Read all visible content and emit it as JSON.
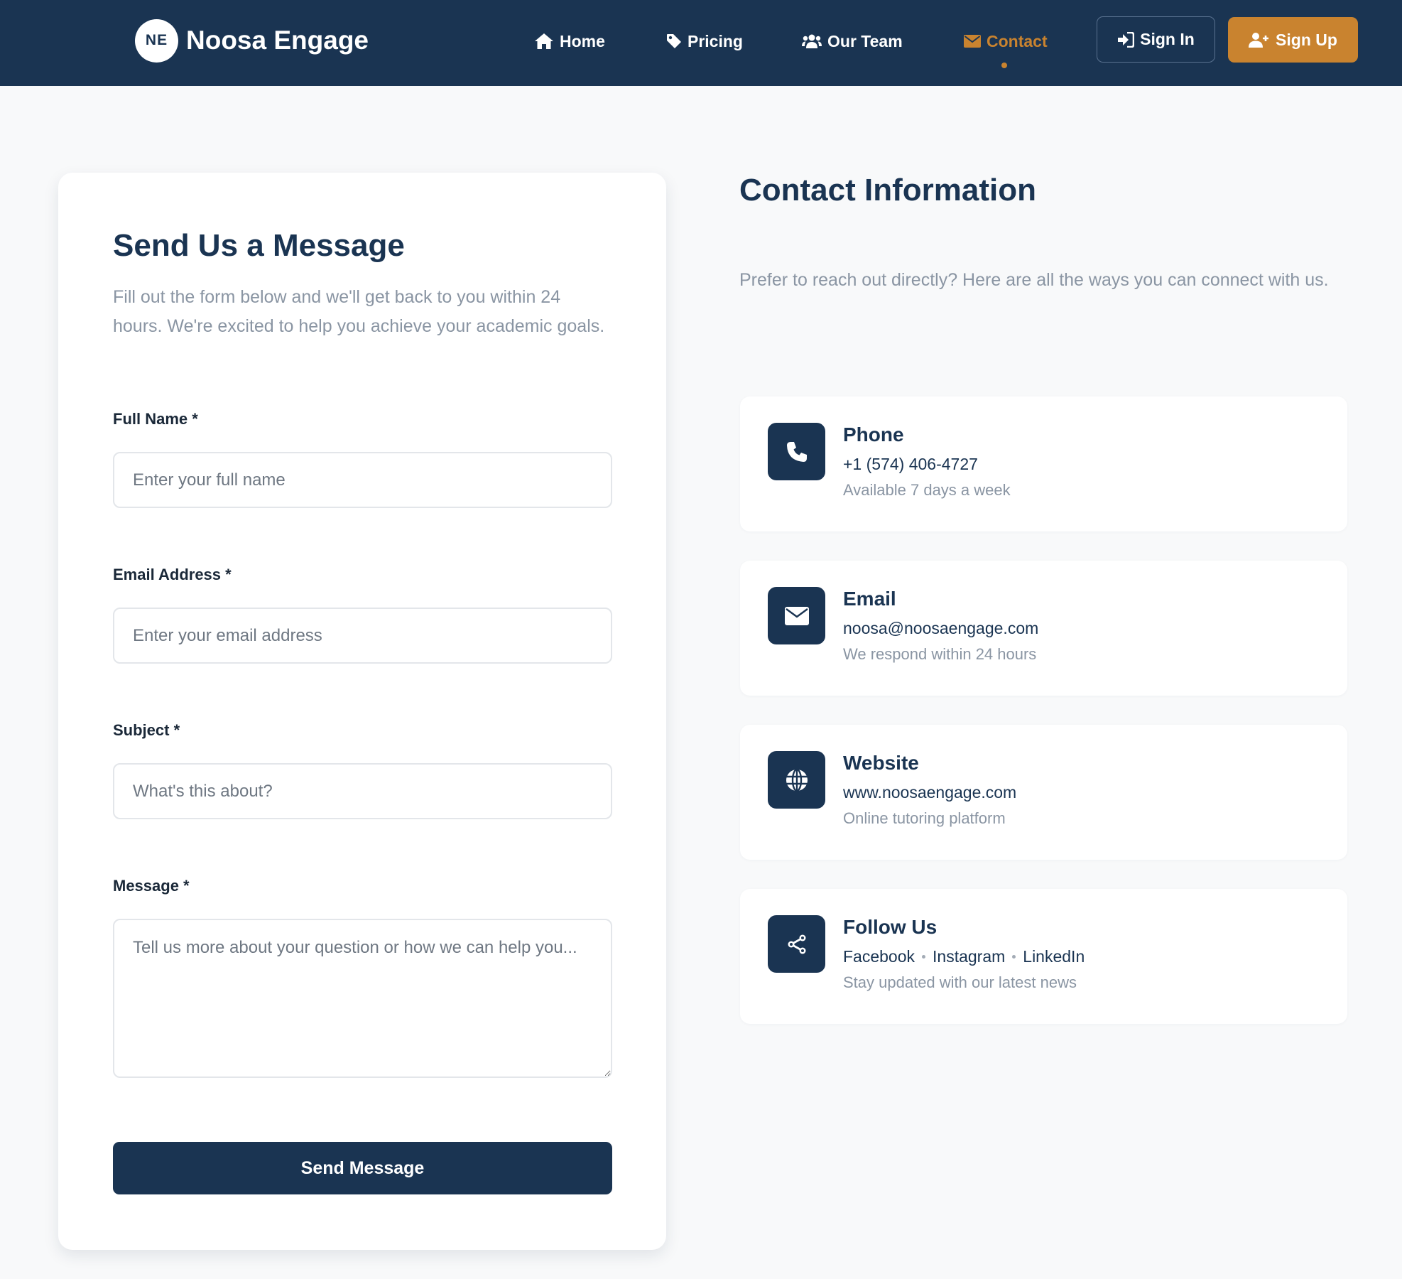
{
  "brand": {
    "logo_text": "NE",
    "name": "Noosa Engage"
  },
  "nav": {
    "links": [
      {
        "label": "Home",
        "icon": "home-icon"
      },
      {
        "label": "Pricing",
        "icon": "tag-icon"
      },
      {
        "label": "Our Team",
        "icon": "users-icon"
      },
      {
        "label": "Contact",
        "icon": "envelope-icon",
        "active": true
      }
    ],
    "sign_in": "Sign In",
    "sign_up": "Sign Up"
  },
  "form": {
    "title": "Send Us a Message",
    "subtitle": "Fill out the form below and we'll get back to you within 24 hours. We're excited to help you achieve your academic goals.",
    "fields": [
      {
        "label": "Full Name *",
        "placeholder": "Enter your full name"
      },
      {
        "label": "Email Address *",
        "placeholder": "Enter your email address"
      },
      {
        "label": "Subject *",
        "placeholder": "What's this about?"
      },
      {
        "label": "Message *",
        "placeholder": "Tell us more about your question or how we can help you..."
      }
    ],
    "submit": "Send Message"
  },
  "contact": {
    "title": "Contact Information",
    "subtitle": "Prefer to reach out directly? Here are all the ways you can connect with us.",
    "cards": [
      {
        "name": "Phone",
        "value": "+1 (574) 406-4727",
        "note": "Available 7 days a week",
        "icon": "phone-icon"
      },
      {
        "name": "Email",
        "value": "noosa@noosaengage.com",
        "note": "We respond within 24 hours",
        "icon": "envelope-icon"
      },
      {
        "name": "Website",
        "value": "www.noosaengage.com",
        "note": "Online tutoring platform",
        "icon": "globe-icon"
      },
      {
        "name": "Follow Us",
        "socials": [
          "Facebook",
          "Instagram",
          "LinkedIn"
        ],
        "note": "Stay updated with our latest news",
        "icon": "share-icon"
      }
    ]
  },
  "colors": {
    "navy": "#1a3452",
    "accent": "#c9832f",
    "muted": "#8a95a3",
    "background": "#f8f9fa"
  }
}
